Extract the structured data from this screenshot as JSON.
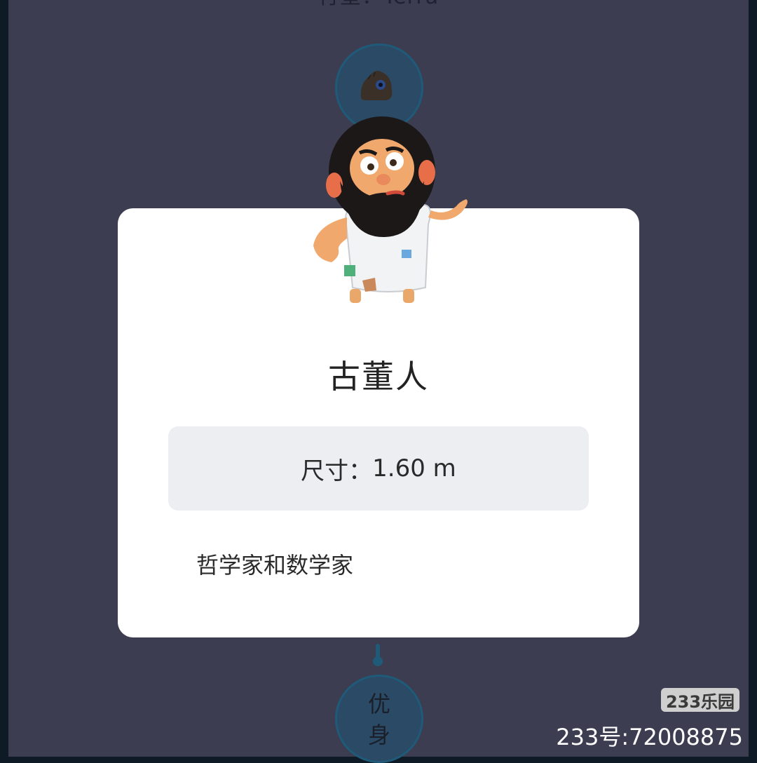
{
  "header": {
    "planet_label": "行星：Terra"
  },
  "card": {
    "title": "古董人",
    "size_label": "尺寸：",
    "size_value": "1.60 m",
    "description": "哲学家和数学家"
  },
  "next_node": {
    "line1": "优",
    "line2": "身"
  },
  "watermark": {
    "badge": "233乐园",
    "id_text": "233号:72008875"
  },
  "colors": {
    "background": "#3d3d52",
    "card": "#ffffff",
    "size_box": "#eceef2",
    "node": "#2a4a66"
  },
  "icons": {
    "previous_creature": "creature-icon",
    "character": "philosopher-character"
  }
}
